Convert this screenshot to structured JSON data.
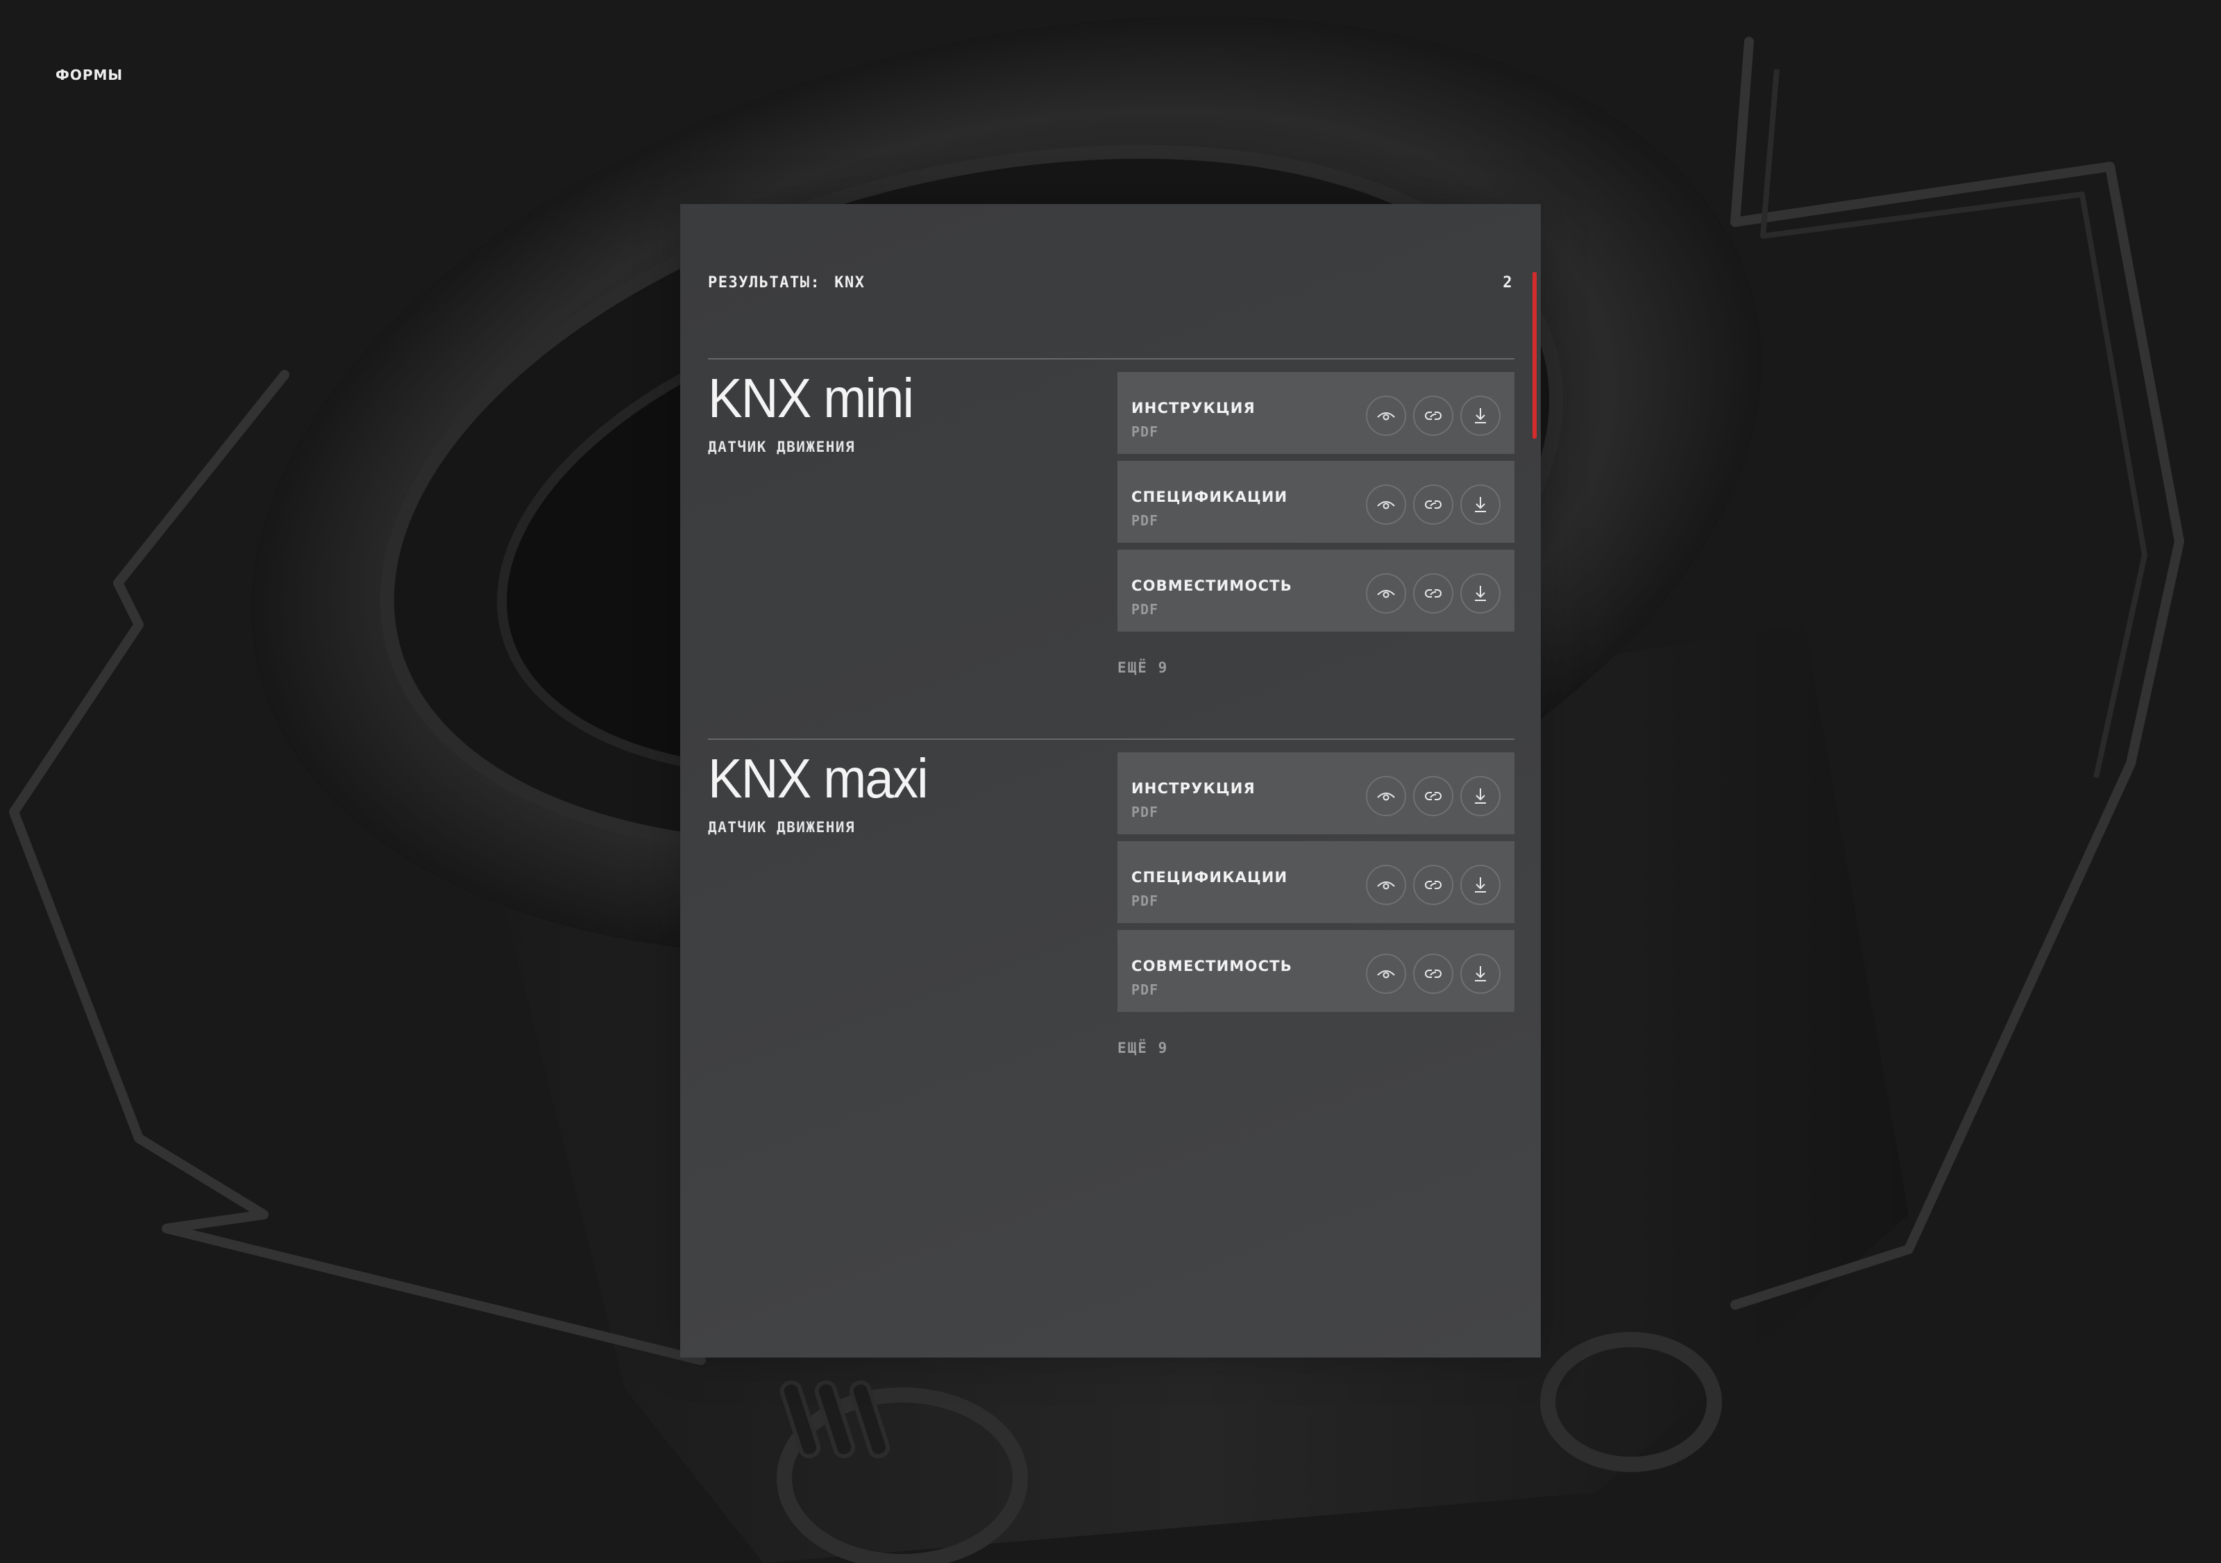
{
  "nav": {
    "forms_label": "ФОРМЫ"
  },
  "results": {
    "label": "РЕЗУЛЬТАТЫ:",
    "query": "KNX",
    "count": "2"
  },
  "products": [
    {
      "name": "KNX mini",
      "subtitle": "ДАТЧИК ДВИЖЕНИЯ",
      "docs": [
        {
          "title": "ИНСТРУКЦИЯ",
          "type": "PDF"
        },
        {
          "title": "СПЕЦИФИКАЦИИ",
          "type": "PDF"
        },
        {
          "title": "СОВМЕСТИМОСТЬ",
          "type": "PDF"
        }
      ],
      "more_label": "ЕЩЁ 9"
    },
    {
      "name": "KNX maxi",
      "subtitle": "ДАТЧИК ДВИЖЕНИЯ",
      "docs": [
        {
          "title": "ИНСТРУКЦИЯ",
          "type": "PDF"
        },
        {
          "title": "СПЕЦИФИКАЦИИ",
          "type": "PDF"
        },
        {
          "title": "СОВМЕСТИМОСТЬ",
          "type": "PDF"
        }
      ],
      "more_label": "ЕЩЁ 9"
    }
  ],
  "icons": {
    "view": "eye-icon",
    "link": "link-icon",
    "download": "download-icon"
  },
  "colors": {
    "accent": "#d42b2b",
    "background": "#191919",
    "panel": "#3e3f41",
    "row": "#565759"
  }
}
